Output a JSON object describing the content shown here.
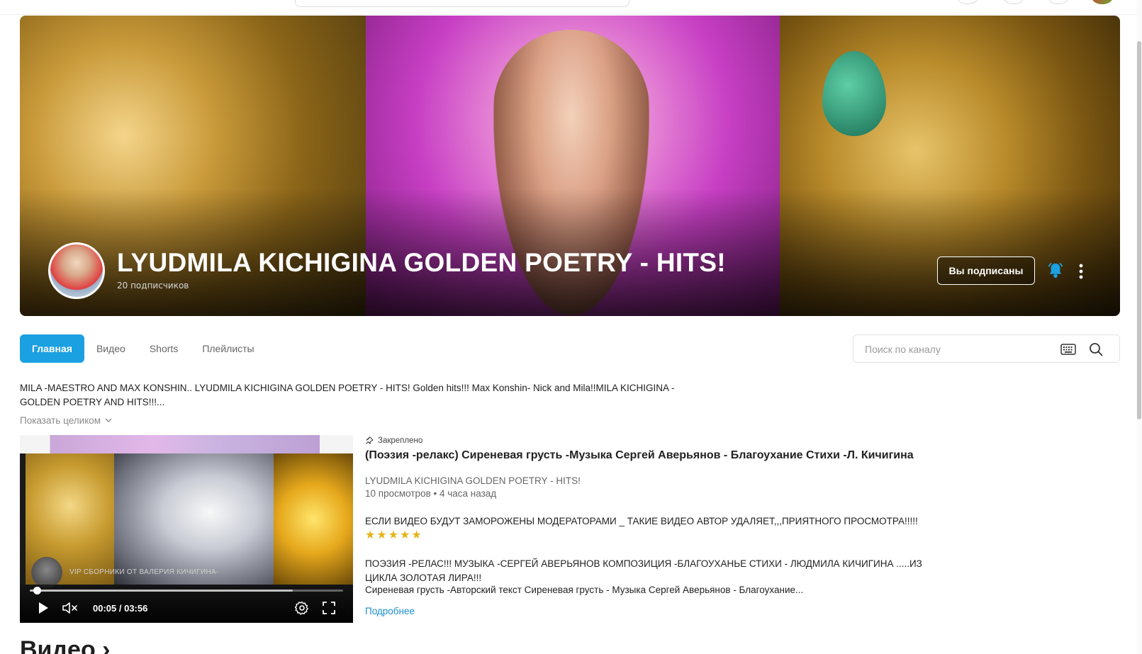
{
  "channel": {
    "title": "LYUDMILA KICHIGINA GOLDEN POETRY - HITS!",
    "subscribers": "20 подписчиков",
    "subscribe_label": "Вы подписаны"
  },
  "tabs": [
    {
      "label": "Главная",
      "active": true
    },
    {
      "label": "Видео",
      "active": false
    },
    {
      "label": "Shorts",
      "active": false
    },
    {
      "label": "Плейлисты",
      "active": false
    }
  ],
  "channel_search": {
    "placeholder": "Поиск по каналу"
  },
  "description": {
    "text": "MILA -MAESTRO AND MAX KONSHIN.. LYUDMILA KICHIGINA GOLDEN POETRY - HITS! Golden hits!!! Max Konshin- Nick and Mila!!MILA KICHIGINA - GOLDEN POETRY AND HITS!!!...",
    "show_more": "Показать целиком"
  },
  "player": {
    "overlay_text": "VIP СБОРНИКИ ОТ ВАЛЕРИЯ КИЧИГИНА-",
    "time": "00:05 / 03:56",
    "progress": 0.022,
    "buffered": 0.84
  },
  "featured_video": {
    "pinned_label": "Закреплено",
    "title": "(Поэзия -релакс) Сиреневая грусть -Музыка Сергей Аверьянов - Благоухание Стихи -Л. Кичигина",
    "channel": "LYUDMILA KICHIGINA GOLDEN POETRY - HITS!",
    "views": "10 просмотров",
    "separator": "•",
    "age": "4 часа назад",
    "desc_line1": "ЕСЛИ ВИДЕО БУДУТ ЗАМОРОЖЕНЫ МОДЕРАТОРАМИ _ ТАКИЕ ВИДЕО АВТОР УДАЛЯЕТ,,,ПРИЯТНОГО ПРОСМОТРА!!!!!",
    "stars": "★★★★★",
    "desc_line2": "ПОЭЗИЯ -РЕЛАС!!! МУЗЫКА -СЕРГЕЙ АВЕРЬЯНОВ КОМПОЗИЦИЯ -БЛАГОУХАНЬЕ СТИХИ - ЛЮДМИЛА КИЧИГИНА .....ИЗ ЦИКЛА ЗОЛОТАЯ ЛИРА!!!",
    "desc_line3": "Сиреневая грусть -Авторский текст Сиреневая грусть - Музыка Сергей Аверьянов - Благоухание...",
    "more_label": "Подробнее"
  },
  "section": {
    "heading": "Видео ›"
  },
  "colors": {
    "accent": "#1ba0e2",
    "link": "#1b8fd0",
    "bell": "#1ba0e2"
  }
}
